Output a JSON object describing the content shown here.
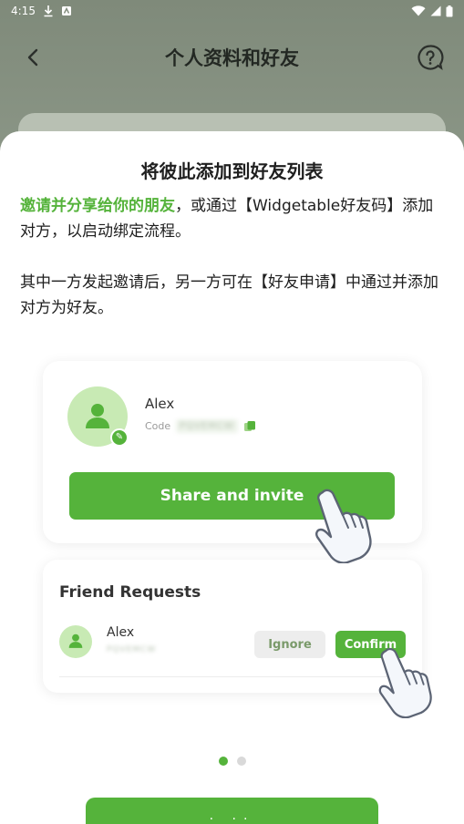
{
  "status_bar": {
    "time": "4:15",
    "left_icons": [
      "download-icon",
      "notification-icon"
    ],
    "right_icons": [
      "wifi-icon",
      "signal-icon",
      "battery-icon"
    ]
  },
  "header": {
    "title": "个人资料和好友",
    "back_icon": "back-chevron-icon",
    "help_icon": "help-icon"
  },
  "sheet": {
    "title": "将彼此添加到好友列表",
    "desc1_highlight": "邀请并分享给你的朋友",
    "desc1_rest": "，或通过【Widgetable好友码】添加对方，以启动绑定流程。",
    "desc2": "其中一方发起邀请后，另一方可在【好友申请】中通过并添加对方为好友。",
    "illustration": {
      "name": "Alex",
      "code_label": "Code",
      "code_value": "PQVEMCW",
      "share_button": "Share and invite"
    },
    "requests": {
      "title": "Friend Requests",
      "name": "Alex",
      "code_value": "PQVEMCW",
      "ignore_label": "Ignore",
      "confirm_label": "Confirm"
    },
    "pager": {
      "total": 2,
      "current": 1
    },
    "bottom_button_label": ". .."
  },
  "colors": {
    "accent": "#55b33b",
    "avatar_bg": "#c8eab4",
    "background_dim": "#8c9886"
  }
}
